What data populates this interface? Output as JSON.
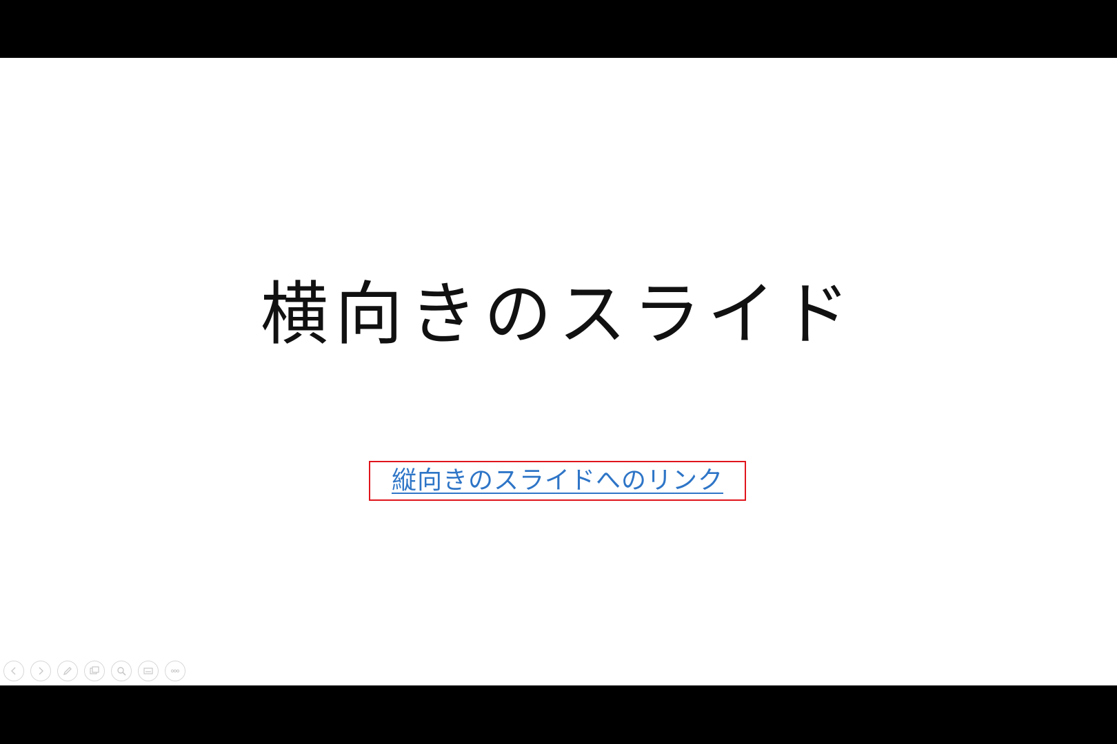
{
  "slide": {
    "title": "横向きのスライド",
    "link_text": "縦向きのスライドへのリンク",
    "colors": {
      "background": "#ffffff",
      "title": "#111111",
      "link": "#2e75c7",
      "highlight_border": "#e0141c",
      "letterbox": "#000000"
    }
  },
  "controls": {
    "icons": [
      "previous-slide-icon",
      "next-slide-icon",
      "pen-icon",
      "see-all-slides-icon",
      "zoom-icon",
      "subtitles-icon",
      "more-options-icon"
    ]
  }
}
